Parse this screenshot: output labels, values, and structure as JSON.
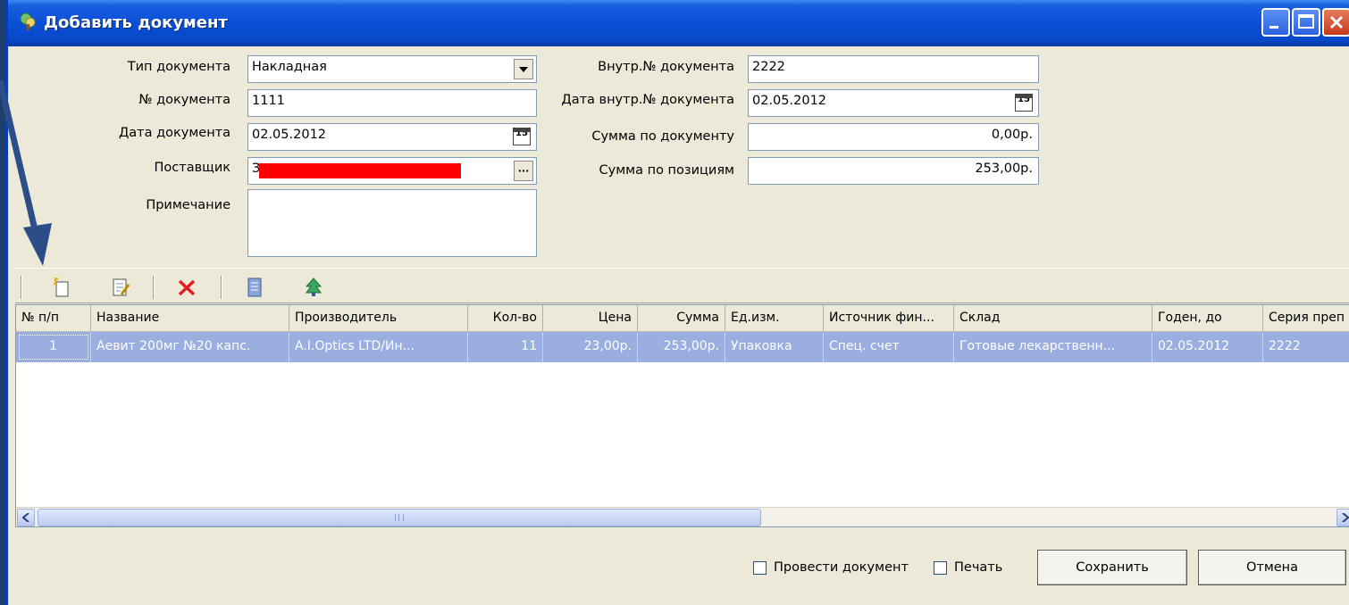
{
  "window": {
    "title": "Добавить документ"
  },
  "form": {
    "doc_type_label": "Тип документа",
    "doc_type_value": "Накладная",
    "doc_num_label": "№ документа",
    "doc_num_value": "1111",
    "doc_date_label": "Дата документа",
    "doc_date_value": "02.05.2012",
    "supplier_label": "Поставщик",
    "supplier_value": "З",
    "note_label": "Примечание",
    "note_value": "",
    "inner_num_label": "Внутр.№ документа",
    "inner_num_value": "2222",
    "inner_date_label": "Дата внутр.№ документа",
    "inner_date_value": "02.05.2012",
    "doc_sum_label": "Сумма по документу",
    "doc_sum_value": "0,00р.",
    "pos_sum_label": "Сумма по позициям",
    "pos_sum_value": "253,00р.",
    "calendar_glyph": "15",
    "ellipsis_glyph": "···"
  },
  "grid": {
    "columns": [
      "№ п/п",
      "Название",
      "Производитель",
      "Кол-во",
      "Цена",
      "Сумма",
      "Ед.изм.",
      "Источник фин...",
      "Склад",
      "Годен, до",
      "Серия преп"
    ],
    "rows": [
      [
        "1",
        "Аевит 200мг №20 капс.",
        "A.I.Optics LTD/Ин...",
        "11",
        "23,00р.",
        "253,00р.",
        "Упаковка",
        "Спец. счет",
        "Готовые лекарственн...",
        "02.05.2012",
        "2222"
      ]
    ],
    "selection_color": "#9aaee0"
  },
  "footer": {
    "post_label": "Провести документ",
    "print_label": "Печать",
    "save_label": "Сохранить",
    "cancel_label": "Отмена"
  },
  "colors": {
    "titlebar": "#0a4fd6",
    "window_bg": "#ece9d8",
    "redaction": "#ff0000",
    "annotation_arrow": "#2c4e88"
  }
}
